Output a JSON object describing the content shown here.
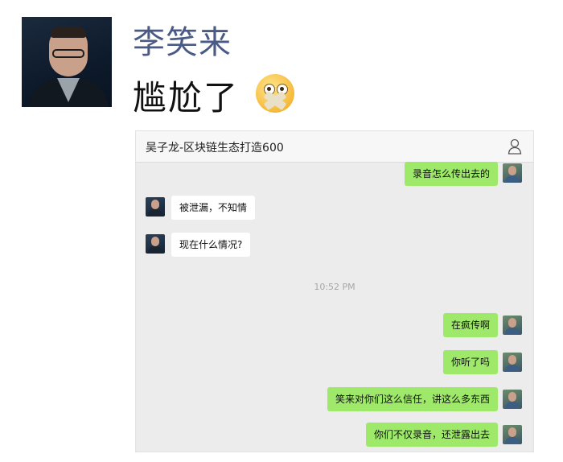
{
  "post": {
    "author": "李笑来",
    "text": "尴尬了"
  },
  "chat": {
    "title": "吴子龙-区块链生态打造600",
    "timestamp": "10:52 PM",
    "messages": [
      {
        "side": "right",
        "text": "录音怎么传出去的"
      },
      {
        "side": "left",
        "text": "被泄漏，不知情"
      },
      {
        "side": "left",
        "text": "现在什么情况?"
      },
      {
        "side": "right",
        "text": "在疯传啊"
      },
      {
        "side": "right",
        "text": "你听了吗"
      },
      {
        "side": "right",
        "text": "笑来对你们这么信任，讲这么多东西"
      },
      {
        "side": "right",
        "text": "你们不仅录音，还泄露出去"
      }
    ]
  },
  "colors": {
    "author_name": "#4a5a86",
    "bubble_right": "#9ee86a",
    "bubble_left": "#ffffff",
    "chat_bg": "#ececec"
  },
  "icons": [
    "profile-photo",
    "shushing-face-emoji",
    "person-icon"
  ]
}
